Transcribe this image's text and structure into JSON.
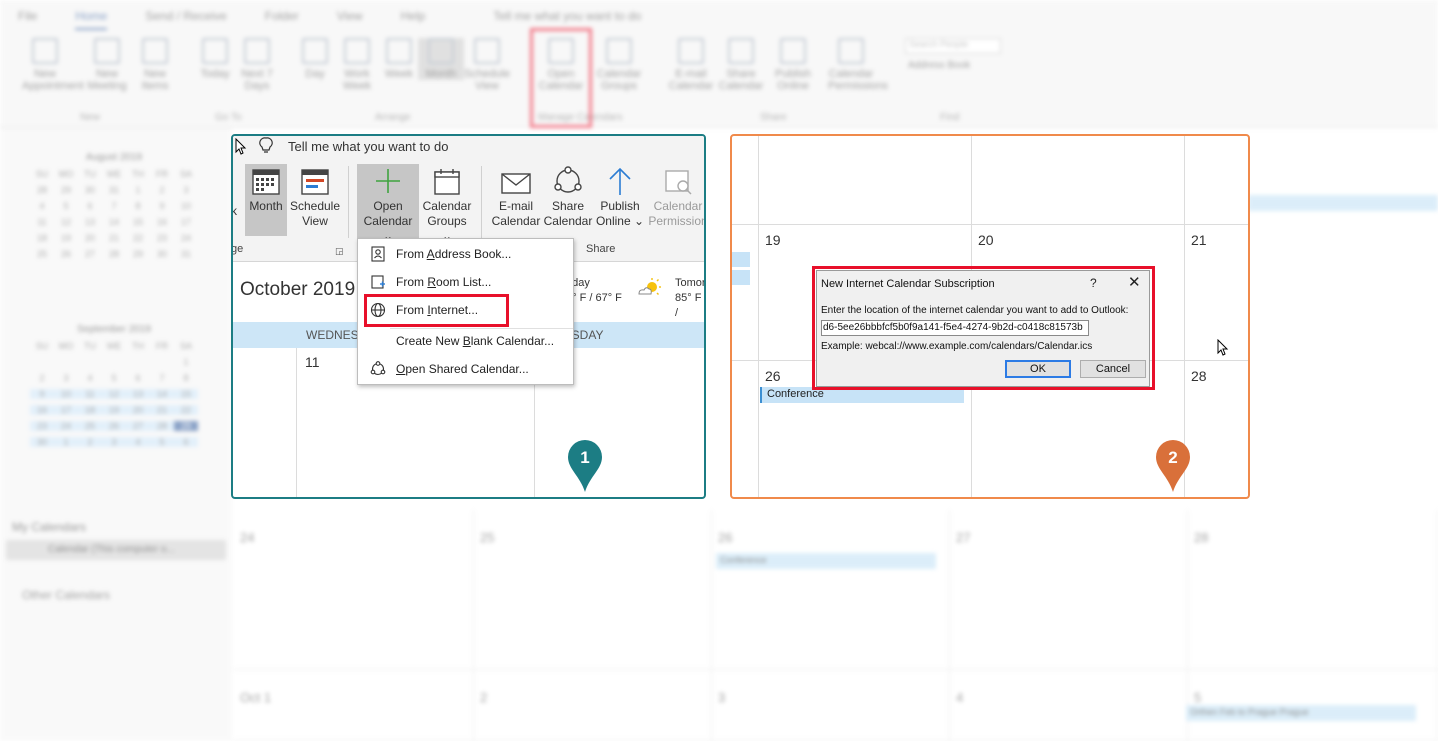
{
  "background": {
    "tabs": [
      "File",
      "Home",
      "Send / Receive",
      "Folder",
      "View",
      "Help"
    ],
    "tell_me": "Tell me what you want to do",
    "ribbon_buttons": [
      {
        "label": "New Appointment"
      },
      {
        "label": "New Meeting"
      },
      {
        "label": "New Items"
      },
      {
        "label": "Today"
      },
      {
        "label": "Next 7 Days"
      },
      {
        "label": "Day"
      },
      {
        "label": "Work Week"
      },
      {
        "label": "Week"
      },
      {
        "label": "Month"
      },
      {
        "label": "Schedule View"
      },
      {
        "label": "Open Calendar"
      },
      {
        "label": "Calendar Groups"
      },
      {
        "label": "E-mail Calendar"
      },
      {
        "label": "Share Calendar"
      },
      {
        "label": "Publish Online"
      },
      {
        "label": "Calendar Permissions"
      }
    ],
    "group_names": {
      "new": "New",
      "goto": "Go To",
      "arrange": "Arrange",
      "manage": "Manage Calendars",
      "share": "Share",
      "find": "Find"
    },
    "search_people": "Search People",
    "address_book": "Address Book",
    "mini_cal_1": {
      "title": "August 2019",
      "days": [
        "SU",
        "MO",
        "TU",
        "WE",
        "TH",
        "FR",
        "SA"
      ],
      "dates": [
        "28",
        "29",
        "30",
        "31",
        "1",
        "2",
        "3",
        "4",
        "5",
        "6",
        "7",
        "8",
        "9",
        "10",
        "11",
        "12",
        "13",
        "14",
        "15",
        "16",
        "17",
        "18",
        "19",
        "20",
        "21",
        "22",
        "23",
        "24",
        "25",
        "26",
        "27",
        "28",
        "29",
        "30",
        "31"
      ]
    },
    "mini_cal_2": {
      "title": "September 2019",
      "days": [
        "SU",
        "MO",
        "TU",
        "WE",
        "TH",
        "FR",
        "SA"
      ],
      "dates": [
        "",
        "",
        "",
        "",
        "",
        "",
        "1",
        "2",
        "3",
        "4",
        "5",
        "6",
        "7",
        "8",
        "9",
        "10",
        "11",
        "12",
        "13",
        "14",
        "15",
        "16",
        "17",
        "18",
        "19",
        "20",
        "21",
        "22",
        "23",
        "24",
        "25",
        "26",
        "27",
        "28",
        "29",
        "30",
        "1",
        "2",
        "3",
        "4",
        "5",
        "6"
      ]
    },
    "my_calendars": "My Calendars",
    "calendar_item": "Calendar (This computer o...",
    "other_calendars": "Other Calendars",
    "grid_days": [
      "24",
      "25",
      "26",
      "27",
      "28",
      "Oct 1",
      "2",
      "3",
      "4",
      "5"
    ],
    "grid_events": [
      "Conference",
      "Orthen Feb to Prague Prague"
    ]
  },
  "panel1": {
    "tell_me": "Tell me what you want to do",
    "ribbon": {
      "week_partial": "k",
      "month": "Month",
      "schedule_view": [
        "Schedule",
        "View"
      ],
      "open_calendar": [
        "Open",
        "Calendar ⌄"
      ],
      "calendar_groups": [
        "Calendar",
        "Groups ⌄"
      ],
      "email_calendar": [
        "E-mail",
        "Calendar"
      ],
      "share_calendar": [
        "Share",
        "Calendar"
      ],
      "publish_online": [
        "Publish",
        "Online ⌄"
      ],
      "calendar_permissions": [
        "Calendar",
        "Permission"
      ],
      "group_arrange_partial": "ge",
      "group_share": "Share"
    },
    "date_title": "October 2019",
    "weather": [
      {
        "day": "oday",
        "temp": "3° F / 67° F"
      },
      {
        "day": "Tomor",
        "temp": "85° F /"
      }
    ],
    "day_headers": [
      "WEDNESD",
      "RSDAY"
    ],
    "day_number": "11",
    "dropdown": [
      {
        "pre": "From ",
        "ul": "A",
        "post": "ddress Book...",
        "icon": "contact-card-icon"
      },
      {
        "pre": "From ",
        "ul": "R",
        "post": "oom List...",
        "icon": "room-list-icon"
      },
      {
        "pre": "From ",
        "ul": "I",
        "post": "nternet...",
        "icon": "globe-icon"
      },
      {
        "pre": "Create New ",
        "ul": "B",
        "post": "lank Calendar...",
        "icon": ""
      },
      {
        "pre": "",
        "ul": "O",
        "post": "pen Shared Calendar...",
        "icon": "shared-calendar-icon"
      }
    ],
    "badge": "1"
  },
  "panel2": {
    "day_numbers": [
      "19",
      "20",
      "21",
      "26",
      "28"
    ],
    "event": "Conference",
    "badge": "2",
    "dialog": {
      "title": "New Internet Calendar Subscription",
      "help": "?",
      "close": "✕",
      "label": "Enter the location of the internet calendar you want to add to Outlook:",
      "input_value": "d6-5ee26bbbfcf5b0f9a141-f5e4-4274-9b2d-c0418c81573b",
      "example": "Example: webcal://www.example.com/calendars/Calendar.ics",
      "ok": "OK",
      "cancel": "Cancel"
    }
  },
  "colors": {
    "teal_border": "#1c7d84",
    "orange_border": "#f08a4b",
    "highlight_red": "#e8102a",
    "accent_blue": "#2b579a"
  }
}
